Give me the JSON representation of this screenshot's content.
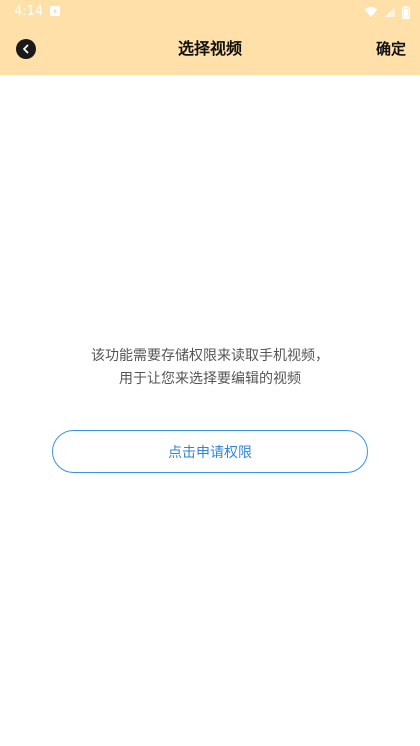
{
  "status_bar": {
    "time": "4:14"
  },
  "app_bar": {
    "title": "选择视频",
    "confirm_label": "确定"
  },
  "permission": {
    "message_line1": "该功能需要存储权限来读取手机视频，",
    "message_line2": "用于让您来选择要编辑的视频",
    "button_label": "点击申请权限"
  },
  "colors": {
    "header_bg": "#FFE0A8",
    "accent": "#2F86DA",
    "text_secondary": "#555555"
  }
}
